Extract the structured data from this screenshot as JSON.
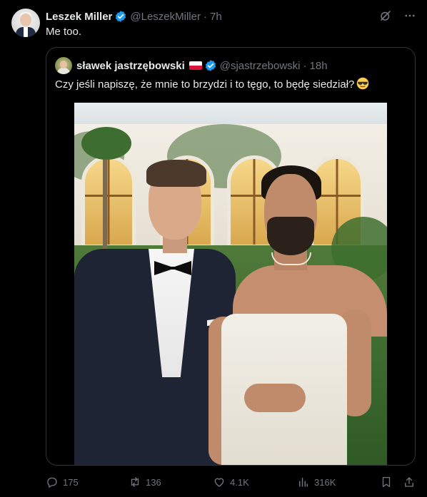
{
  "tweet": {
    "author_name": "Leszek Miller",
    "author_handle": "@LeszekMiller",
    "separator": "·",
    "time": "7h",
    "text": "Me too."
  },
  "quote": {
    "author_name": "sławek jastrzębowski",
    "author_handle": "@sjastrzebowski",
    "separator": "·",
    "time": "18h",
    "text": "Czy jeśli napiszę, że mnie to brzydzi i to tęgo, to będę siedział?"
  },
  "actions": {
    "replies": "175",
    "reposts": "136",
    "likes": "4.1K",
    "views": "316K"
  },
  "colors": {
    "background": "#000000",
    "text": "#e7e9ea",
    "muted": "#71767b",
    "verified": "#1d9bf0",
    "border": "#2f3336"
  },
  "icons": [
    "verified-badge-icon",
    "grok-icon",
    "more-icon",
    "poland-flag-icon",
    "cool-emoji-icon",
    "reply-icon",
    "repost-icon",
    "like-icon",
    "views-icon",
    "bookmark-icon",
    "share-icon"
  ]
}
